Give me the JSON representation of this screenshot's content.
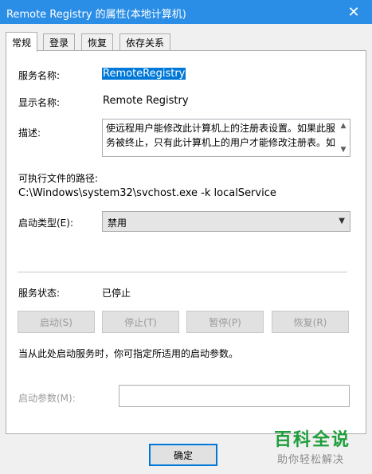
{
  "window": {
    "title": "Remote Registry 的属性(本地计算机)",
    "close_glyph": "✕"
  },
  "tabs": [
    {
      "label": "常规",
      "active": true
    },
    {
      "label": "登录",
      "active": false
    },
    {
      "label": "恢复",
      "active": false
    },
    {
      "label": "依存关系",
      "active": false
    }
  ],
  "general": {
    "service_name_label": "服务名称:",
    "service_name": "RemoteRegistry",
    "display_name_label": "显示名称:",
    "display_name": "Remote Registry",
    "description_label": "描述:",
    "description": "使远程用户能修改此计算机上的注册表设置。如果此服务被终止，只有此计算机上的用户才能修改注册表。如",
    "exe_path_label": "可执行文件的路径:",
    "exe_path": "C:\\Windows\\system32\\svchost.exe -k localService",
    "startup_type_label": "启动类型(E):",
    "startup_type_value": "禁用",
    "status_label": "服务状态:",
    "status_value": "已停止",
    "buttons": {
      "start": "启动(S)",
      "stop": "停止(T)",
      "pause": "暂停(P)",
      "resume": "恢复(R)"
    },
    "hint": "当从此处启动服务时，你可指定所适用的启动参数。",
    "params_label": "启动参数(M):",
    "params_value": ""
  },
  "footer": {
    "ok_label": "确定"
  },
  "watermark": {
    "main": "百科全说",
    "sub": "助你轻松解决"
  },
  "colors": {
    "titlebar": "#2b8ee6",
    "selection": "#0078d7",
    "watermark_green": "#1e9e3a"
  }
}
